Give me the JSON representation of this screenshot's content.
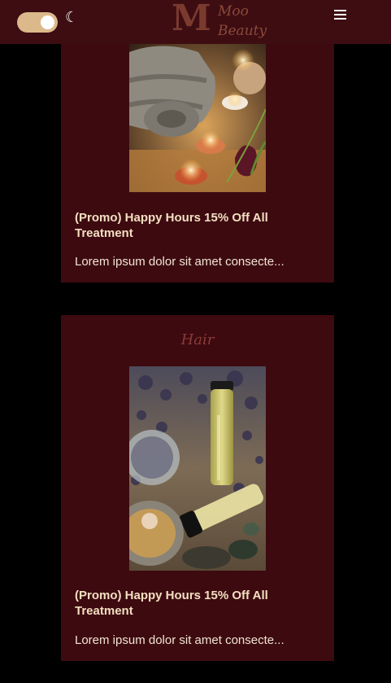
{
  "header": {
    "brand_initial": "M",
    "brand_line1": "Moo",
    "brand_line2": "Beauty",
    "dark_mode_icon": "moon-icon",
    "menu_icon": "hamburger-menu-icon"
  },
  "posts": [
    {
      "category": "",
      "title": "(Promo) Happy Hours 15% Off All Treatment",
      "excerpt": "Lorem ipsum dolor sit amet consecte..."
    },
    {
      "category": "Hair",
      "title": "(Promo) Happy Hours 15% Off All Treatment",
      "excerpt": "Lorem ipsum dolor sit amet consecte..."
    }
  ],
  "colors": {
    "header_bg": "#3d0d12",
    "card_bg": "#3d0a10",
    "accent_brand": "#7a3a2e",
    "toggle": "#dcb98a",
    "title_text": "#f3dfc0"
  }
}
